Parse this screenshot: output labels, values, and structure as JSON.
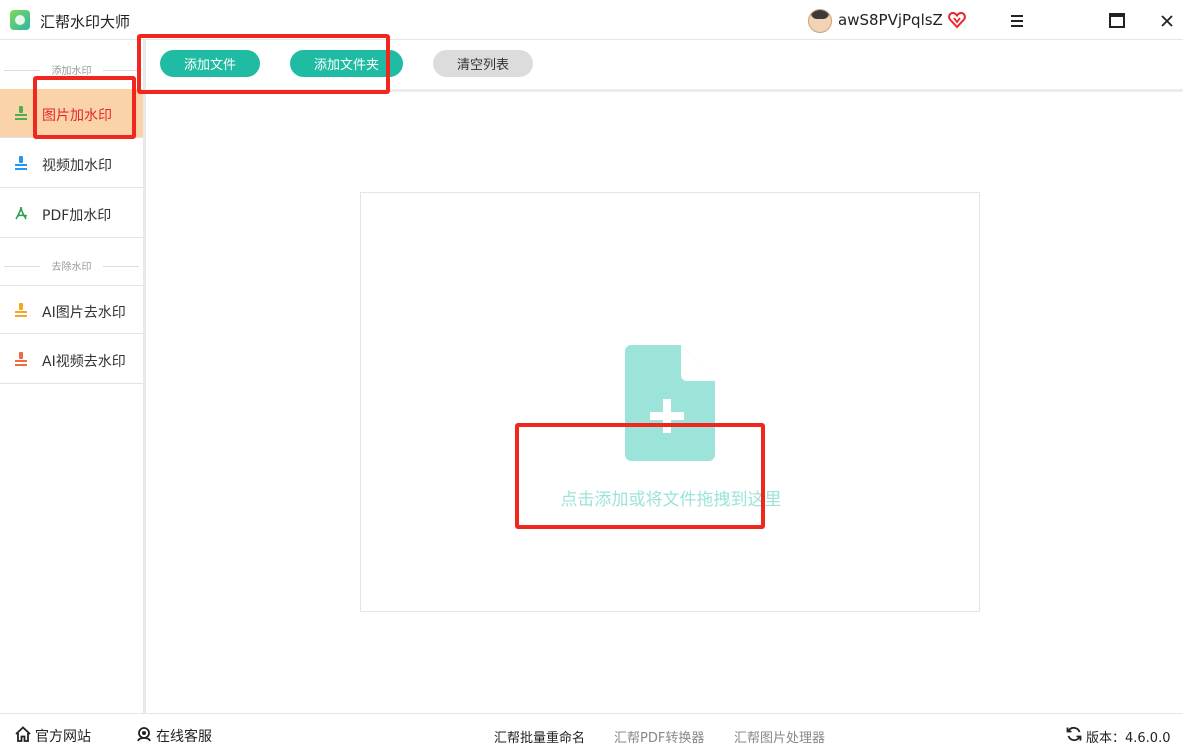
{
  "titlebar": {
    "app_title": "汇帮水印大师",
    "username": "awS8PVjPqlsZ"
  },
  "sidebar": {
    "section_add": "添加水印",
    "section_remove": "去除水印",
    "items": [
      {
        "label": "图片加水印",
        "icon": "image-watermark-icon",
        "active": true
      },
      {
        "label": "视频加水印",
        "icon": "video-watermark-icon",
        "active": false
      },
      {
        "label": "PDF加水印",
        "icon": "pdf-icon",
        "active": false
      },
      {
        "label": "AI图片去水印",
        "icon": "image-remove-watermark-icon",
        "active": false
      },
      {
        "label": "AI视频去水印",
        "icon": "video-remove-watermark-icon",
        "active": false
      }
    ]
  },
  "toolbar": {
    "add_file": "添加文件",
    "add_folder": "添加文件夹",
    "clear_list": "清空列表"
  },
  "dropzone": {
    "hint": "点击添加或将文件拖拽到这里"
  },
  "footer": {
    "website": "官方网站",
    "support": "在线客服",
    "rename": "汇帮批量重命名",
    "pdf_converter": "汇帮PDF转换器",
    "image_processor": "汇帮图片处理器",
    "version": "版本：4.6.0.0"
  },
  "colors": {
    "accent": "#1fbba3",
    "active_bg": "#fbd3a8",
    "active_text": "#e8262d",
    "annotation": "#f0271f",
    "drop_icon": "#9ce3d9"
  }
}
